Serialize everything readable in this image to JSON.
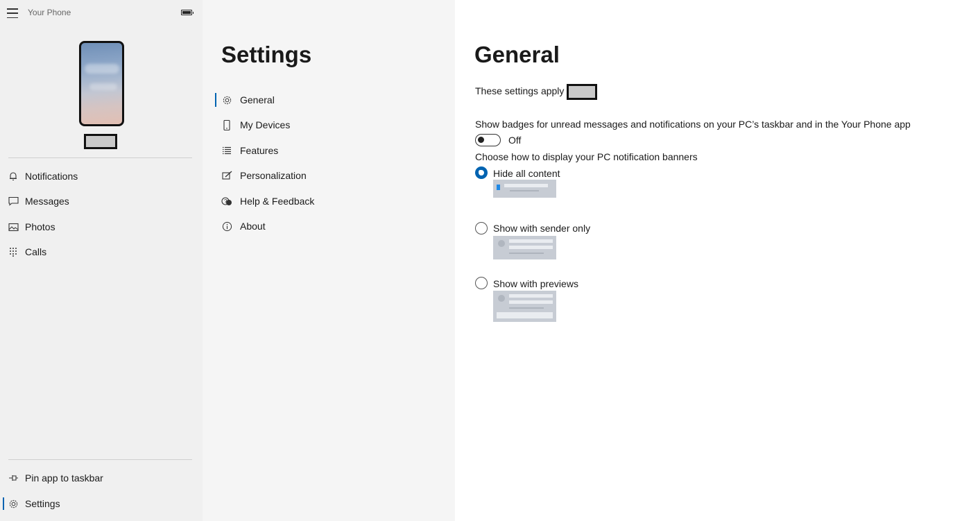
{
  "app": {
    "title": "Your Phone"
  },
  "sidebar": {
    "items": [
      {
        "label": "Notifications",
        "icon": "bell-icon"
      },
      {
        "label": "Messages",
        "icon": "chat-icon"
      },
      {
        "label": "Photos",
        "icon": "photos-icon"
      },
      {
        "label": "Calls",
        "icon": "dialpad-icon"
      }
    ],
    "bottom": [
      {
        "label": "Pin app to taskbar",
        "icon": "pin-icon"
      },
      {
        "label": "Settings",
        "icon": "gear-icon"
      }
    ]
  },
  "settings_nav": {
    "title": "Settings",
    "items": [
      {
        "label": "General",
        "icon": "gear-icon"
      },
      {
        "label": "My Devices",
        "icon": "phone-icon"
      },
      {
        "label": "Features",
        "icon": "list-icon"
      },
      {
        "label": "Personalization",
        "icon": "pen-icon"
      },
      {
        "label": "Help & Feedback",
        "icon": "help-icon"
      },
      {
        "label": "About",
        "icon": "info-icon"
      }
    ]
  },
  "general": {
    "title": "General",
    "apply_text": "These settings apply to",
    "badges_text": "Show badges for unread messages and notifications on your PC’s taskbar and in the Your Phone app",
    "badges_toggle": {
      "state": "Off",
      "on": false
    },
    "display_text": "Choose how to display your PC notification banners",
    "options": [
      {
        "label": "Hide all content",
        "selected": true
      },
      {
        "label": "Show with sender only",
        "selected": false
      },
      {
        "label": "Show with previews",
        "selected": false
      }
    ]
  },
  "colors": {
    "accent": "#0063b1",
    "sidebar_bg": "#f0f0f0",
    "nav_bg": "#f5f5f5"
  }
}
